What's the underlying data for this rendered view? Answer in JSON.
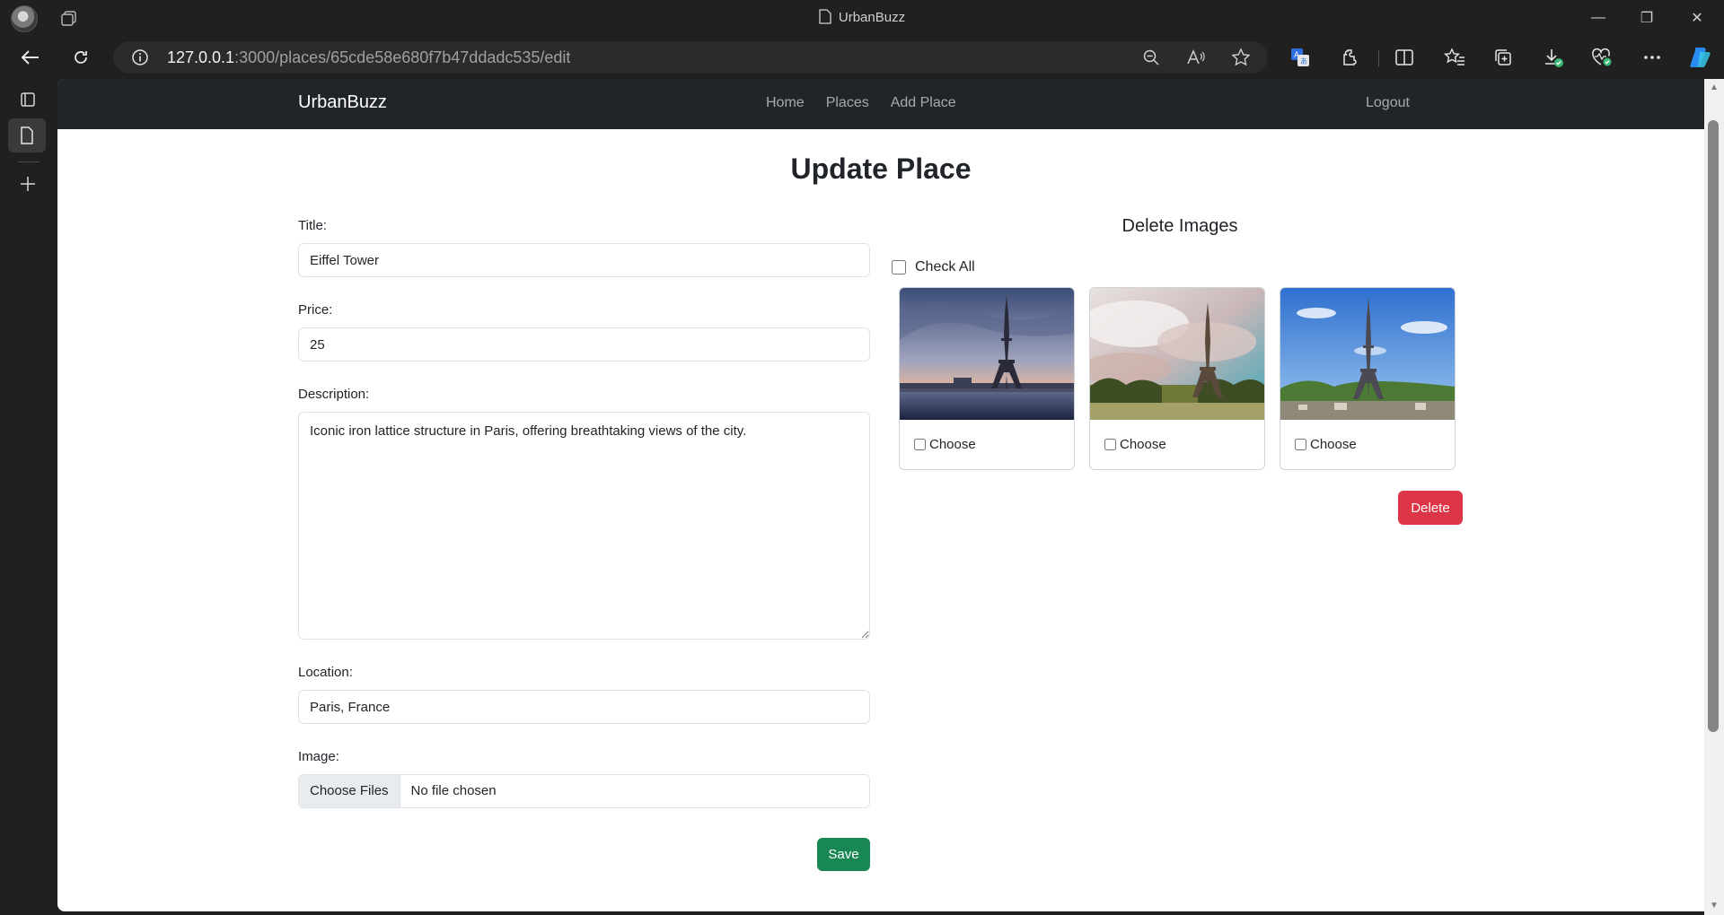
{
  "browser": {
    "window_title": "UrbanBuzz",
    "url_host": "127.0.0.1",
    "url_rest": ":3000/places/65cde58e680f7b47ddadc535/edit"
  },
  "navbar": {
    "brand": "UrbanBuzz",
    "links": [
      "Home",
      "Places",
      "Add Place"
    ],
    "logout": "Logout"
  },
  "page": {
    "title": "Update Place"
  },
  "form": {
    "title_label": "Title:",
    "title_value": "Eiffel Tower",
    "price_label": "Price:",
    "price_value": "25",
    "description_label": "Description:",
    "description_value": "Iconic iron lattice structure in Paris, offering breathtaking views of the city.",
    "location_label": "Location:",
    "location_value": "Paris, France",
    "image_label": "Image:",
    "file_button": "Choose Files",
    "file_status": "No file chosen",
    "save_label": "Save"
  },
  "delete_images": {
    "heading": "Delete Images",
    "check_all_label": "Check All",
    "cards": [
      {
        "choose_label": "Choose",
        "scene": "dusk-river"
      },
      {
        "choose_label": "Choose",
        "scene": "cloudy-park"
      },
      {
        "choose_label": "Choose",
        "scene": "blue-sky"
      }
    ],
    "delete_label": "Delete"
  },
  "colors": {
    "navbar_bg": "#212529",
    "save_button": "#198754",
    "delete_button": "#dc3545"
  }
}
